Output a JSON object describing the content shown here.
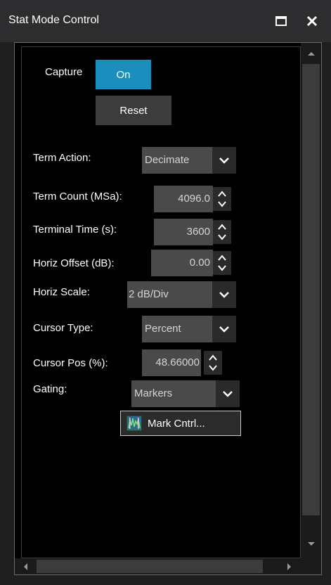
{
  "window": {
    "title": "Stat Mode Control"
  },
  "capture": {
    "label": "Capture",
    "on_label": "On",
    "reset_label": "Reset"
  },
  "term_action": {
    "label": "Term Action:",
    "value": "Decimate"
  },
  "term_count": {
    "label": "Term Count (MSa):",
    "value": "4096.0"
  },
  "terminal_time": {
    "label": "Terminal Time (s):",
    "value": "3600"
  },
  "horiz_offset": {
    "label": "Horiz Offset (dB):",
    "value": "0.00"
  },
  "horiz_scale": {
    "label": "Horiz Scale:",
    "value": "2 dB/Div"
  },
  "cursor_type": {
    "label": "Cursor Type:",
    "value": "Percent"
  },
  "cursor_pos": {
    "label": "Cursor Pos (%):",
    "value": "48.66000"
  },
  "gating": {
    "label": "Gating:",
    "value": "Markers"
  },
  "mark_control": {
    "label": "Mark Cntrl..."
  },
  "colors": {
    "accent": "#1a8fbe",
    "panel": "#000000",
    "control": "#4a4a4a"
  }
}
